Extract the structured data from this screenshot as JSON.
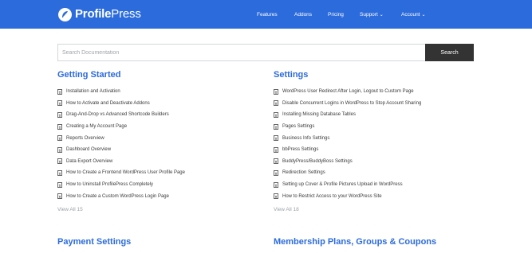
{
  "brand": {
    "name_bold": "Profile",
    "name_rest": "Press",
    "logo_icon": "feather-icon"
  },
  "nav": {
    "features": "Features",
    "addons": "Addons",
    "pricing": "Pricing",
    "support": "Support",
    "account": "Account"
  },
  "search": {
    "placeholder": "Search Documentation",
    "value": "",
    "button": "Search"
  },
  "sections": [
    {
      "title": "Getting Started",
      "items": [
        "Installation and Activation",
        "How to Activate and Deactivate Addons",
        "Drag-And-Drop vs Advanced Shortcode Builders",
        "Creating a My Account Page",
        "Reports Overview",
        "Dashboard Overview",
        "Data Export Overview",
        "How to Create a Frontend WordPress User Profile Page",
        "How to Uninstall ProfilePress Completely",
        "How to Create a Custom WordPress Login Page"
      ],
      "view_all": "View All 15"
    },
    {
      "title": "Settings",
      "items": [
        "WordPress User Redirect After Login, Logout to Custom Page",
        "Disable Concurrent Logins in WordPress to Stop Account Sharing",
        "Installing Missing Database Tables",
        "Pages Settings",
        "Business Info Settings",
        "bbPress Settings",
        "BuddyPress/BuddyBoss Settings",
        "Redirection Settings",
        "Setting up Cover & Profile Pictures Upload in WordPress",
        "How to Restrict Access to your WordPress Site"
      ],
      "view_all": "View All 18"
    },
    {
      "title": "Payment Settings"
    },
    {
      "title": "Membership Plans, Groups & Coupons"
    }
  ],
  "colors": {
    "brand_blue": "#2c6bdc",
    "button_dark": "#333333",
    "muted": "#9aa0a6"
  }
}
